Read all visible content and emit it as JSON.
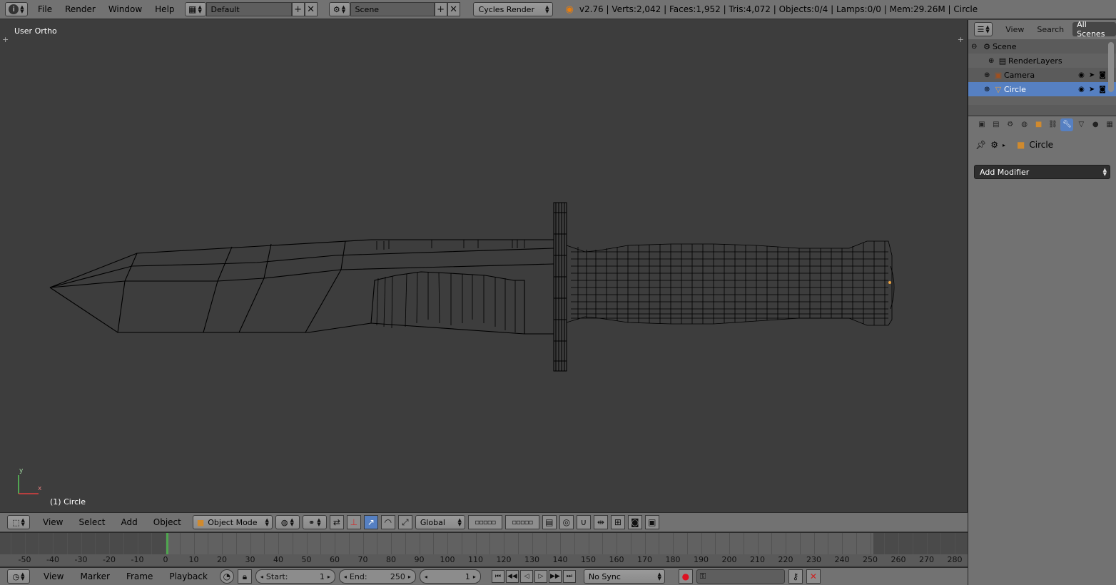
{
  "topbar": {
    "menus": [
      "File",
      "Render",
      "Window",
      "Help"
    ],
    "screen_layout": "Default",
    "scene": "Scene",
    "render_engine": "Cycles Render",
    "stats": "v2.76 | Verts:2,042 | Faces:1,952 | Tris:4,072 | Objects:0/4 | Lamps:0/0 | Mem:29.26M | Circle"
  },
  "viewport": {
    "view_label": "User Ortho",
    "object_label": "(1) Circle",
    "axis_y": "y",
    "axis_x": "x"
  },
  "view3d_header": {
    "menus": [
      "View",
      "Select",
      "Add",
      "Object"
    ],
    "mode": "Object Mode",
    "orientation": "Global"
  },
  "timeline": {
    "ticks": [
      "-50",
      "-40",
      "-30",
      "-20",
      "-10",
      "0",
      "10",
      "20",
      "30",
      "40",
      "50",
      "60",
      "70",
      "80",
      "90",
      "100",
      "110",
      "120",
      "130",
      "140",
      "150",
      "160",
      "170",
      "180",
      "190",
      "200",
      "210",
      "220",
      "230",
      "240",
      "250",
      "260",
      "270",
      "280"
    ],
    "menus": [
      "View",
      "Marker",
      "Frame",
      "Playback"
    ],
    "start_label": "Start:",
    "start_value": "1",
    "end_label": "End:",
    "end_value": "250",
    "current_frame": "1",
    "sync": "No Sync",
    "playhead_frame": 0
  },
  "outliner": {
    "tabs": [
      "View",
      "Search",
      "All Scenes"
    ],
    "rows": [
      {
        "label": "Scene",
        "icon": "scene-icon",
        "indent": 0
      },
      {
        "label": "RenderLayers",
        "icon": "renderlayers-icon",
        "indent": 1
      },
      {
        "label": "Camera",
        "icon": "camera-icon",
        "indent": 1
      },
      {
        "label": "Circle",
        "icon": "mesh-icon",
        "indent": 1
      }
    ]
  },
  "properties": {
    "context_object": "Circle",
    "add_modifier": "Add Modifier"
  },
  "colors": {
    "header_bg": "#727272",
    "viewport_bg": "#3d3d3d",
    "selection_blue": "#5680c2",
    "playhead_green": "#4fa64f"
  }
}
